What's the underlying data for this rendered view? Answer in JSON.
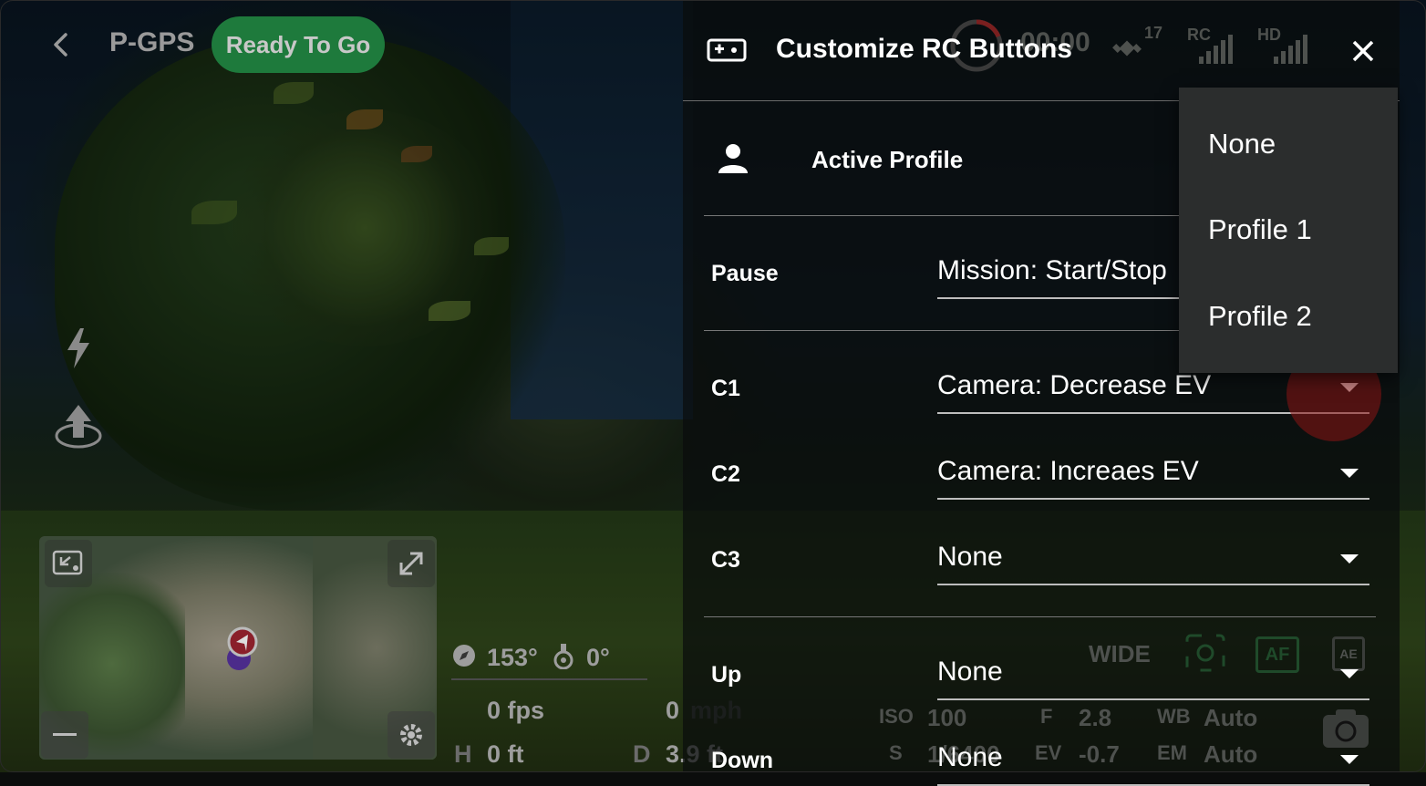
{
  "status_bar": {
    "flight_mode": "P-GPS",
    "ready_status": "Ready To Go",
    "ready_color": "#1e7a3c",
    "back_icon": "chevron-left-icon",
    "recording_timer": "00:00",
    "satellites": "17",
    "rc_label": "RC",
    "hd_label": "HD"
  },
  "telemetry": {
    "heading": "153°",
    "gimbal": "0°",
    "fps": "0 fps",
    "speed_value": "0",
    "speed_unit": "mph",
    "height_label": "H",
    "height_value": "0 ft",
    "distance_label": "D",
    "distance_value": "3.9 ft"
  },
  "camera_controls": {
    "lens": "WIDE",
    "af": "AF",
    "ae": "AE",
    "iso_label": "ISO",
    "iso_value": "100",
    "f_label": "F",
    "f_value": "2.8",
    "wb_label": "WB",
    "wb_value": "Auto",
    "s_label": "S",
    "s_value": "1/6400",
    "ev_label": "EV",
    "ev_value": "-0.7",
    "em_label": "EM",
    "em_value": "Auto"
  },
  "panel": {
    "title": "Customize RC Buttons",
    "active_profile_label": "Active Profile",
    "rows": [
      {
        "label": "Pause",
        "value": "Mission: Start/Stop"
      },
      {
        "label": "C1",
        "value": "Camera: Decrease EV"
      },
      {
        "label": "C2",
        "value": "Camera: Increaes EV"
      },
      {
        "label": "C3",
        "value": "None"
      },
      {
        "label": "Up",
        "value": "None"
      },
      {
        "label": "Down",
        "value": "None"
      }
    ]
  },
  "profile_dropdown": {
    "options": [
      "None",
      "Profile 1",
      "Profile 2"
    ]
  },
  "colors": {
    "accent_green": "#1e7a3c",
    "record_red": "#c0271f"
  }
}
